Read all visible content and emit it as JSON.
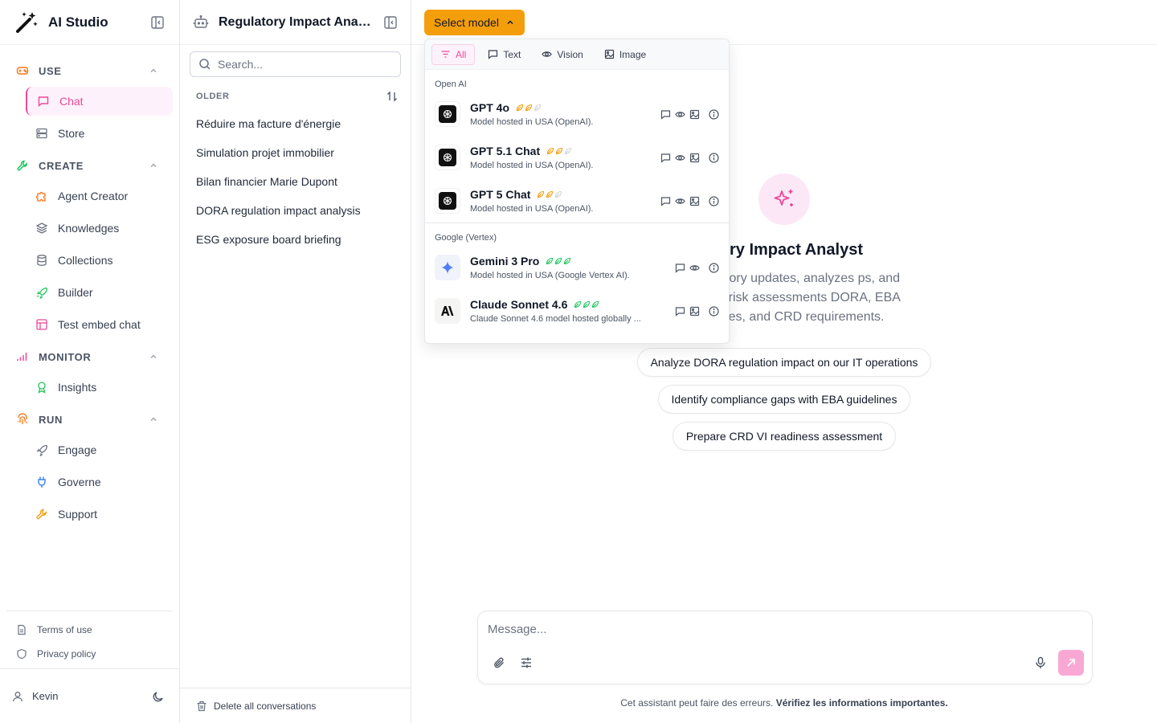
{
  "app": {
    "title": "AI Studio"
  },
  "sidebar": {
    "sections": [
      {
        "label": "USE",
        "items": [
          {
            "label": "Chat",
            "active": true
          },
          {
            "label": "Store"
          }
        ]
      },
      {
        "label": "CREATE",
        "items": [
          {
            "label": "Agent Creator"
          },
          {
            "label": "Knowledges"
          },
          {
            "label": "Collections"
          },
          {
            "label": "Builder"
          },
          {
            "label": "Test embed chat"
          }
        ]
      },
      {
        "label": "MONITOR",
        "items": [
          {
            "label": "Insights"
          }
        ]
      },
      {
        "label": "RUN",
        "items": [
          {
            "label": "Engage"
          },
          {
            "label": "Governe"
          },
          {
            "label": "Support"
          }
        ]
      }
    ],
    "footer": {
      "terms": "Terms of use",
      "privacy": "Privacy policy"
    },
    "user": {
      "name": "Kevin"
    }
  },
  "conversations": {
    "title": "Regulatory Impact Anal...",
    "search_placeholder": "Search...",
    "group_label": "OLDER",
    "items": [
      "Réduire ma facture d'énergie",
      "Simulation projet immobilier",
      "Bilan financier Marie Dupont",
      "DORA regulation impact analysis",
      "ESG exposure board briefing"
    ],
    "delete_all": "Delete all conversations"
  },
  "main": {
    "select_model_label": "Select model",
    "agent_name": "atory Impact Analyst",
    "description": "CB regulatory updates, analyzes ps, and generates risk assessments DORA, EBA guidelines, and CRD requirements.",
    "suggestions": [
      "Analyze DORA regulation impact on our IT operations",
      "Identify compliance gaps with EBA guidelines",
      "Prepare CRD VI readiness assessment"
    ],
    "composer_placeholder": "Message...",
    "disclaimer_prefix": "Cet assistant peut faire des erreurs.",
    "disclaimer_bold": "Vérifiez les informations importantes."
  },
  "model_dropdown": {
    "filters": [
      {
        "label": "All",
        "icon": "filter-icon",
        "active": true
      },
      {
        "label": "Text",
        "icon": "message-icon"
      },
      {
        "label": "Vision",
        "icon": "eye-icon"
      },
      {
        "label": "Image",
        "icon": "image-icon"
      }
    ],
    "groups": [
      {
        "label": "Open AI",
        "models": [
          {
            "name": "GPT 4o",
            "desc": "Model hosted in USA (OpenAI).",
            "eco": 2,
            "eco_color": "#f59e0b",
            "caps": [
              "text",
              "vision",
              "image"
            ]
          },
          {
            "name": "GPT 5.1 Chat",
            "desc": "Model hosted in USA (OpenAI).",
            "eco": 2,
            "eco_color": "#f59e0b",
            "caps": [
              "text",
              "vision",
              "image"
            ]
          },
          {
            "name": "GPT 5 Chat",
            "desc": "Model hosted in USA (OpenAI).",
            "eco": 2,
            "eco_color": "#f59e0b",
            "caps": [
              "text",
              "vision",
              "image"
            ]
          }
        ]
      },
      {
        "label": "Google (Vertex)",
        "models": [
          {
            "name": "Gemini 3 Pro",
            "desc": "Model hosted in USA (Google Vertex AI).",
            "eco": 3,
            "eco_color": "#22c55e",
            "caps": [
              "text",
              "vision"
            ]
          },
          {
            "name": "Claude Sonnet 4.6",
            "desc": "Claude Sonnet 4.6 model hosted globally ...",
            "eco": 3,
            "eco_color": "#22c55e",
            "caps": [
              "text",
              "image"
            ]
          }
        ]
      }
    ]
  },
  "colors": {
    "accent": "#ec4899",
    "select_button": "#f59e0b",
    "eco_medium": "#f59e0b",
    "eco_high": "#22c55e"
  }
}
